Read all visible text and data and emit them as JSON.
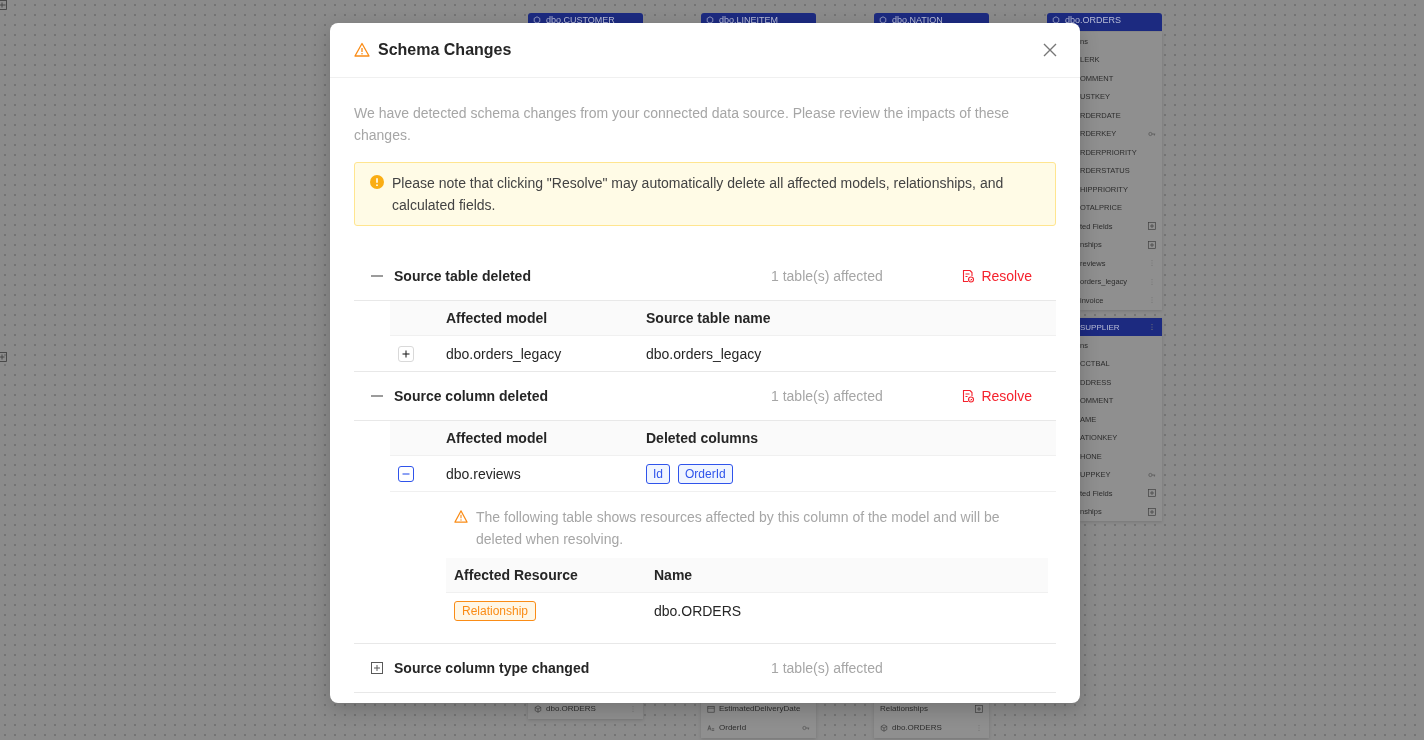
{
  "canvas": {
    "top_nodes": [
      {
        "title": "dbo.CUSTOMER"
      },
      {
        "title": "dbo.LINEITEM"
      },
      {
        "title": "dbo.NATION"
      },
      {
        "title": "dbo.ORDERS"
      }
    ],
    "right_nodes": [
      {
        "rows": [
          {
            "kind": "field",
            "text": "ns"
          },
          {
            "kind": "field",
            "text": "LERK"
          },
          {
            "kind": "field",
            "text": "OMMENT"
          },
          {
            "kind": "field",
            "text": "USTKEY"
          },
          {
            "kind": "field",
            "text": "RDERDATE"
          },
          {
            "kind": "key",
            "text": "RDERKEY"
          },
          {
            "kind": "field",
            "text": "RDERPRIORITY"
          },
          {
            "kind": "field",
            "text": "RDERSTATUS"
          },
          {
            "kind": "field",
            "text": "HIPPRIORITY"
          },
          {
            "kind": "field",
            "text": "OTALPRICE"
          },
          {
            "kind": "group",
            "text": "ted Fields"
          },
          {
            "kind": "group",
            "text": "nships"
          },
          {
            "kind": "relation",
            "text": "reviews"
          },
          {
            "kind": "relation",
            "text": "orders_legacy"
          },
          {
            "kind": "relation",
            "text": "invoice"
          }
        ]
      },
      {
        "title": "SUPPLIER",
        "rows": [
          {
            "kind": "field",
            "text": "ns"
          },
          {
            "kind": "field",
            "text": "CCTBAL"
          },
          {
            "kind": "field",
            "text": "DDRESS"
          },
          {
            "kind": "field",
            "text": "OMMENT"
          },
          {
            "kind": "field",
            "text": "AME"
          },
          {
            "kind": "field",
            "text": "ATIONKEY"
          },
          {
            "kind": "field",
            "text": "HONE"
          },
          {
            "kind": "key",
            "text": "UPPKEY"
          },
          {
            "kind": "group",
            "text": "ted Fields"
          },
          {
            "kind": "group",
            "text": "nships"
          }
        ]
      }
    ],
    "bottom_nodes": [
      {
        "rows": [
          {
            "kind": "model",
            "text": "dbo.ORDERS"
          }
        ]
      },
      {
        "rows": [
          {
            "kind": "date",
            "text": "EstimatedDeliveryDate"
          },
          {
            "kind": "keytext",
            "text": "OrderId"
          }
        ]
      },
      {
        "rows": [
          {
            "kind": "group",
            "text": "Relationships"
          },
          {
            "kind": "model",
            "text": "dbo.ORDERS"
          }
        ]
      }
    ]
  },
  "modal": {
    "title": "Schema Changes",
    "description": "We have detected schema changes from your connected data source. Please review the impacts of these changes.",
    "alert": "Please note that clicking \"Resolve\" may automatically delete all affected models, relationships, and calculated fields.",
    "sections": [
      {
        "title": "Source table deleted",
        "count": "1 table(s) affected",
        "resolve": "Resolve",
        "expanded": true,
        "columns": [
          "Affected model",
          "Source table name"
        ],
        "rows": [
          {
            "expanded": false,
            "model": "dbo.orders_legacy",
            "value": "dbo.orders_legacy"
          }
        ]
      },
      {
        "title": "Source column deleted",
        "count": "1 table(s) affected",
        "resolve": "Resolve",
        "expanded": true,
        "columns": [
          "Affected model",
          "Deleted columns"
        ],
        "rows": [
          {
            "expanded": true,
            "model": "dbo.reviews",
            "tags": [
              "Id",
              "OrderId"
            ],
            "detail": {
              "note": "The following table shows resources affected by this column of the model and will be deleted when resolving.",
              "columns": [
                "Affected Resource",
                "Name"
              ],
              "rows": [
                {
                  "resource": "Relationship",
                  "name": "dbo.ORDERS"
                }
              ]
            }
          }
        ]
      },
      {
        "title": "Source column type changed",
        "count": "1 table(s) affected",
        "expanded": false
      }
    ]
  }
}
